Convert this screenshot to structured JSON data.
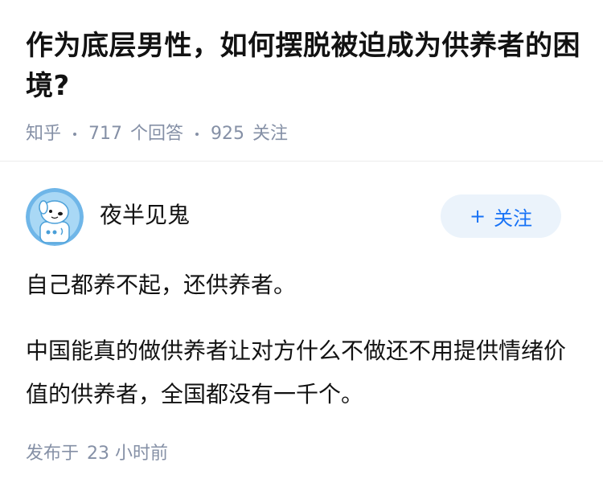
{
  "question": {
    "title": "作为底层男性，如何摆脱被迫成为供养者的困境?",
    "source": "知乎",
    "answer_count": "717",
    "answer_label": "个回答",
    "follower_count": "925",
    "follower_label": "关注"
  },
  "author": {
    "name": "夜半见鬼",
    "avatar_icon": "cartoon-dog-avatar",
    "follow_label": "关注",
    "follow_icon": "plus-icon",
    "accent_color": "#1772f6"
  },
  "answer": {
    "paragraphs": [
      "自己都养不起，还供养者。",
      "中国能真的做供养者让对方什么不做还不用提供情绪价值的供养者，全国都没有一千个。"
    ],
    "publish_label": "发布于",
    "publish_time": "23 小时前"
  }
}
